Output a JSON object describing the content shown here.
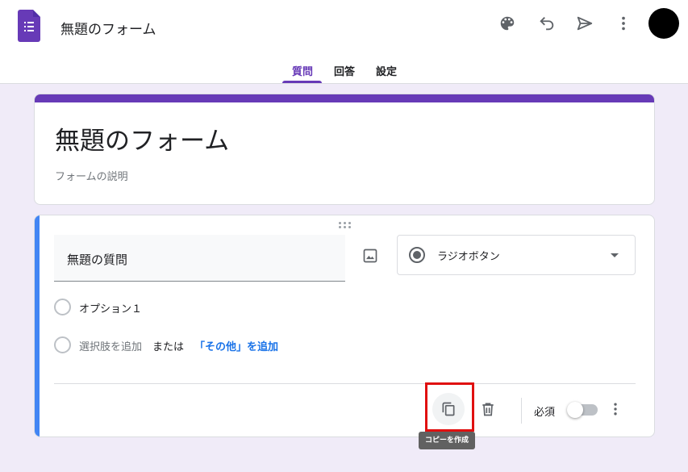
{
  "header": {
    "app_title": "無題のフォーム",
    "icons": [
      "palette-icon",
      "undo-icon",
      "send-icon",
      "more-vert-icon"
    ],
    "brand_color": "#673ab7"
  },
  "tabs": [
    {
      "label": "質問",
      "active": true
    },
    {
      "label": "回答",
      "active": false
    },
    {
      "label": "設定",
      "active": false
    }
  ],
  "title_card": {
    "title": "無題のフォーム",
    "description_placeholder": "フォームの説明"
  },
  "question_card": {
    "question_text": "無題の質問",
    "type_label": "ラジオボタン",
    "options": [
      {
        "label": "オプション１"
      }
    ],
    "add_option": "選択肢を追加",
    "or_text": "または",
    "add_other": "「その他」を追加",
    "required_label": "必須",
    "required": false,
    "accent_color": "#4285f4"
  },
  "tooltip": {
    "text": "コピーを作成"
  }
}
